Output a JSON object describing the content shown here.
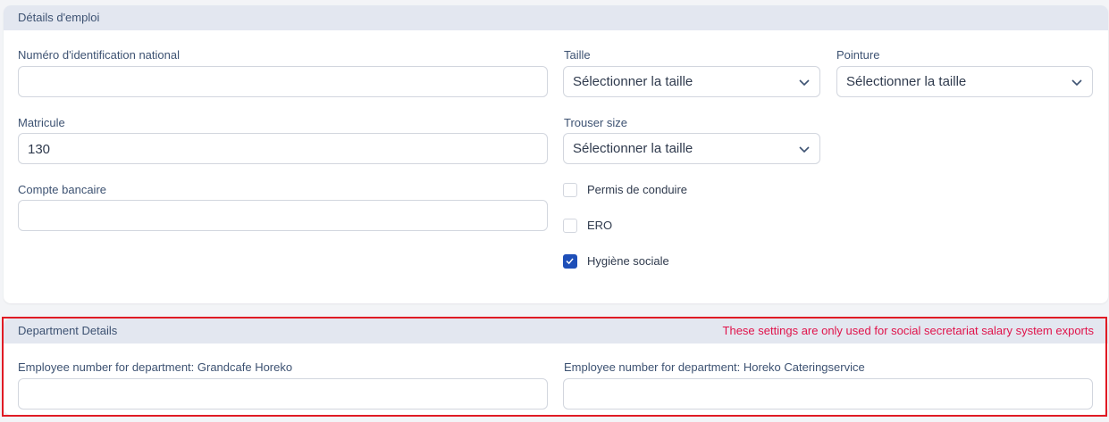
{
  "employment": {
    "title": "Détails d'emploi",
    "national_id": {
      "label": "Numéro d'identification national",
      "value": ""
    },
    "size": {
      "label": "Taille",
      "selected": "Sélectionner la taille"
    },
    "shoe_size": {
      "label": "Pointure",
      "selected": "Sélectionner la taille"
    },
    "employee_number": {
      "label": "Matricule",
      "value": "130"
    },
    "trouser_size": {
      "label": "Trouser size",
      "selected": "Sélectionner la taille"
    },
    "bank_account": {
      "label": "Compte bancaire",
      "value": ""
    },
    "checkboxes": [
      {
        "label": "Permis de conduire",
        "checked": false
      },
      {
        "label": "ERO",
        "checked": false
      },
      {
        "label": "Hygiène sociale",
        "checked": true
      }
    ]
  },
  "department": {
    "title": "Department Details",
    "notice": "These settings are only used for social secretariat salary system exports",
    "fields": [
      {
        "label": "Employee number for department: Grandcafe Horeko",
        "value": ""
      },
      {
        "label": "Employee number for department: Horeko Cateringservice",
        "value": ""
      }
    ]
  },
  "colors": {
    "header_bg": "#e3e7f0",
    "label_text": "#3d5272",
    "checkbox_checked": "#1e4fb8",
    "notice_text": "#e0124a",
    "highlight_border": "#e01b24"
  },
  "icons": {
    "select_arrow": "chevron-down-icon",
    "check": "check-icon"
  }
}
